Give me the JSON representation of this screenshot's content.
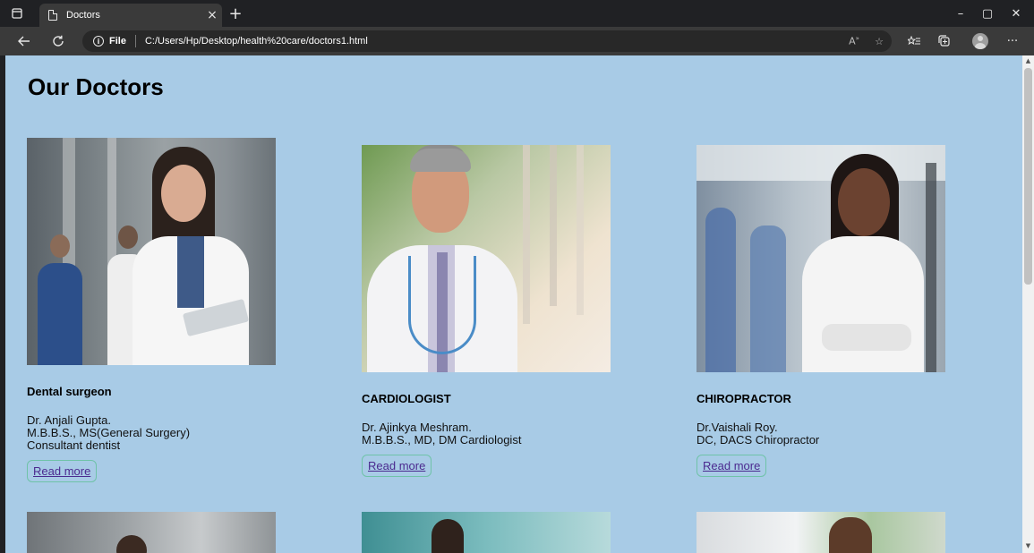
{
  "browser": {
    "tab_title": "Doctors",
    "tab_close": "×",
    "new_tab": "+",
    "file_label": "File",
    "url": "C:/Users/Hp/Desktop/health%20care/doctors1.html",
    "window_controls": {
      "minimize": "–",
      "restore": "▢",
      "close": "✕"
    },
    "icons": [
      "tab-actions-icon",
      "back-icon",
      "refresh-icon",
      "info-icon",
      "read-aloud-icon",
      "favorite-icon",
      "favorites-list-icon",
      "collections-icon",
      "profile-icon",
      "more-icon"
    ]
  },
  "page": {
    "title": "Our Doctors",
    "doctors": [
      {
        "specialty": "Dental surgeon",
        "name": "Dr. Anjali Gupta.",
        "qualification": "M.B.B.S., MS(General Surgery)",
        "role": "Consultant dentist",
        "button": "Read more"
      },
      {
        "specialty": "CARDIOLOGIST",
        "name": "Dr. Ajinkya Meshram.",
        "qualification": "M.B.B.S., MD, DM Cardiologist",
        "role": "",
        "button": "Read more"
      },
      {
        "specialty": "CHIROPRACTOR",
        "name": "Dr.Vaishali Roy.",
        "qualification": "DC, DACS Chiropractor",
        "role": "",
        "button": "Read more"
      }
    ]
  },
  "colors": {
    "page_background": "#a8cbe6",
    "button_border": "#6fc3a8",
    "link_text": "#4b2a8f",
    "chrome_dark": "#202124",
    "chrome_toolbar": "#3a3a3a"
  }
}
